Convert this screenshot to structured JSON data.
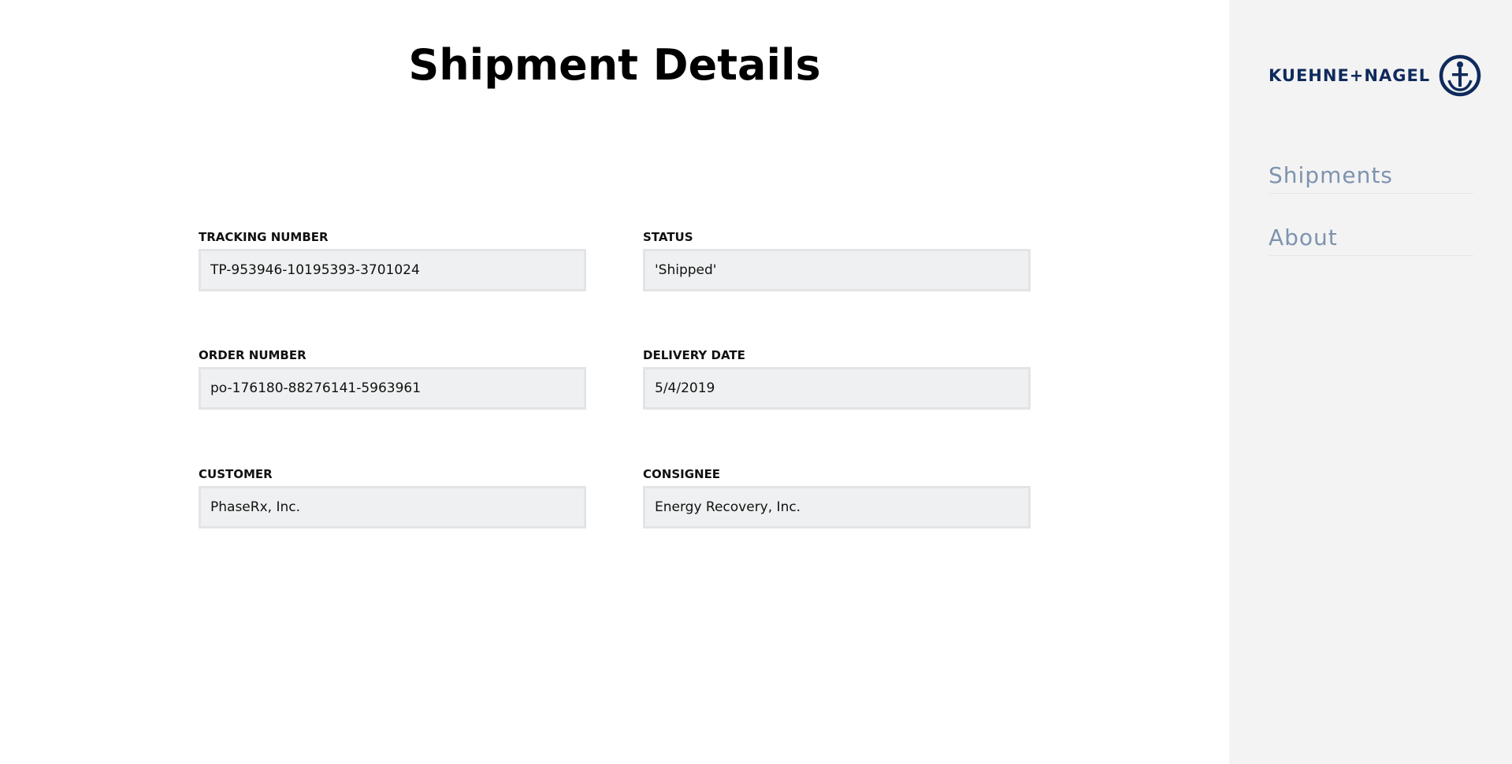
{
  "page": {
    "title": "Shipment Details"
  },
  "fields": {
    "tracking_number": {
      "label": "TRACKING NUMBER",
      "value": "TP-953946-10195393-3701024"
    },
    "status": {
      "label": "STATUS",
      "value": "'Shipped'"
    },
    "order_number": {
      "label": "ORDER NUMBER",
      "value": "po-176180-88276141-5963961"
    },
    "delivery_date": {
      "label": "DELIVERY DATE",
      "value": "5/4/2019"
    },
    "customer": {
      "label": "CUSTOMER",
      "value": "PhaseRx, Inc."
    },
    "consignee": {
      "label": "CONSIGNEE",
      "value": "Energy Recovery, Inc."
    }
  },
  "sidebar": {
    "logo": {
      "text": "KUEHNE+NAGEL",
      "icon": "anchor-icon",
      "color": "#0f2a5c"
    },
    "nav": [
      {
        "label": "Shipments"
      },
      {
        "label": "About"
      }
    ],
    "nav_color": "#7e93ad",
    "background": "#f3f3f4"
  }
}
